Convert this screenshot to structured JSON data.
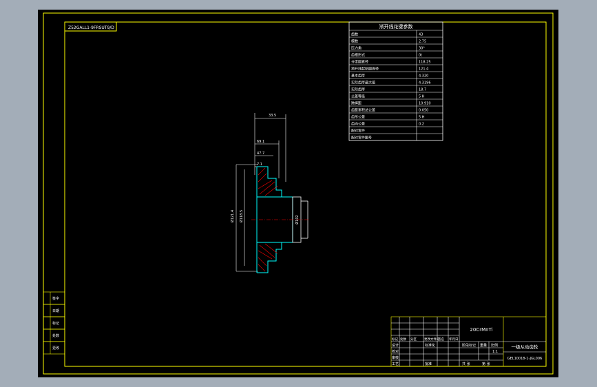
{
  "colors": {
    "background": "#000000",
    "app_chrome": "#a3adb8",
    "frame_line": "#ffff00",
    "text": "#ffffff",
    "section_hatch": "#ff0000",
    "outline_cyan": "#00ffff",
    "centerline": "#ff0000"
  },
  "drawing_code": "Z52GALL1-9FRSUT9/D",
  "parameter_table": {
    "title": "渐开线花键参数",
    "rows": [
      {
        "name": "齿数",
        "value": "43"
      },
      {
        "name": "模数",
        "value": "2.75"
      },
      {
        "name": "压力角",
        "value": "30°"
      },
      {
        "name": "齿根形式",
        "value": "0t"
      },
      {
        "name": "分度圆直径",
        "value": "118.25"
      },
      {
        "name": "渐开线起始圆直径",
        "value": "121.4"
      },
      {
        "name": "基本齿厚",
        "value": "4.320"
      },
      {
        "name": "实际齿厚最大值",
        "value": "4.3196"
      },
      {
        "name": "实际齿厚",
        "value": "18.7"
      },
      {
        "name": "公差等级",
        "value": "5 H"
      },
      {
        "name": "跨棒距",
        "value": "10.910"
      },
      {
        "name": "齿距累积总公差",
        "value": "0.050"
      },
      {
        "name": "齿形公差",
        "value": "5 H"
      },
      {
        "name": "齿向公差",
        "value": "0.2"
      },
      {
        "name": "配对零件",
        "value": ""
      },
      {
        "name": "配对零件图号",
        "value": ""
      }
    ]
  },
  "dimensions": {
    "overall_width": "33.5",
    "dim_1": "69.1",
    "dim_2": "47.7",
    "dim_3": "7.1",
    "dim_left_outer": "Ø121.4",
    "dim_left_inner": "Ø118.5",
    "dim_right": "Ø102"
  },
  "left_stamps": [
    "签字",
    "日期",
    "标记",
    "处数",
    "更改"
  ],
  "title_block": {
    "material": "20CrMnTi",
    "part_name": "一级从动齿轮",
    "drawing_number": "GEL10018-1-JGL006",
    "revision_labels": [
      "标记",
      "处数",
      "分区",
      "更改文件号",
      "签名",
      "年月日"
    ],
    "roles": [
      "设计",
      "校对",
      "审核",
      "工艺"
    ],
    "standardization": "标准化",
    "approval": "批准",
    "stage_label": "阶段标记",
    "weight_label": "重量",
    "scale_label": "比例",
    "scale_value": "1:1",
    "sheet_total": "共  张",
    "sheet_num": "第  张"
  }
}
